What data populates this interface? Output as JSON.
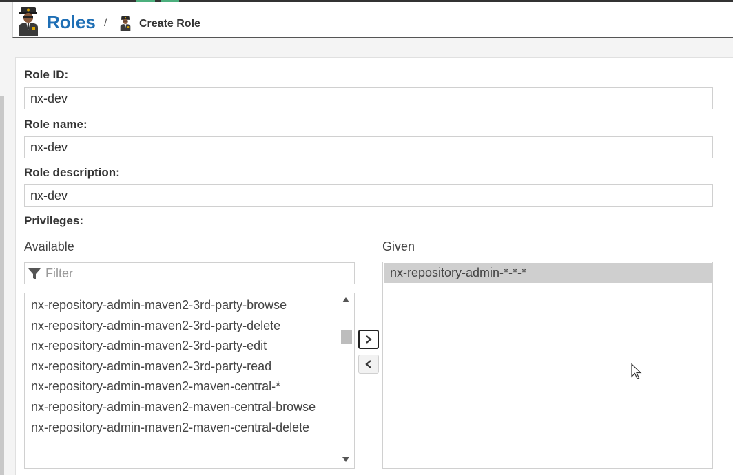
{
  "breadcrumb": {
    "section_title": "Roles",
    "separator": "/",
    "page_title": "Create Role"
  },
  "form": {
    "role_id_label": "Role ID:",
    "role_id_value": "nx-dev",
    "role_name_label": "Role name:",
    "role_name_value": "nx-dev",
    "role_description_label": "Role description:",
    "role_description_value": "nx-dev",
    "privileges_label": "Privileges:"
  },
  "privileges": {
    "available_label": "Available",
    "given_label": "Given",
    "filter_placeholder": "Filter",
    "available_items": [
      "nx-repository-admin-maven2-3rd-party-browse",
      "nx-repository-admin-maven2-3rd-party-delete",
      "nx-repository-admin-maven2-3rd-party-edit",
      "nx-repository-admin-maven2-3rd-party-read",
      "nx-repository-admin-maven2-maven-central-*",
      "nx-repository-admin-maven2-maven-central-browse",
      "nx-repository-admin-maven2-maven-central-delete"
    ],
    "given_items": [
      "nx-repository-admin-*-*-*"
    ]
  },
  "icons": {
    "section_icon": "security-guard-icon",
    "page_icon": "security-guard-icon",
    "filter_icon": "filter-funnel-icon",
    "add_icon": "chevron-right-icon",
    "remove_icon": "chevron-left-icon"
  },
  "colors": {
    "brand_title": "#1f6fb5",
    "selected_row": "#cfcfcf"
  }
}
